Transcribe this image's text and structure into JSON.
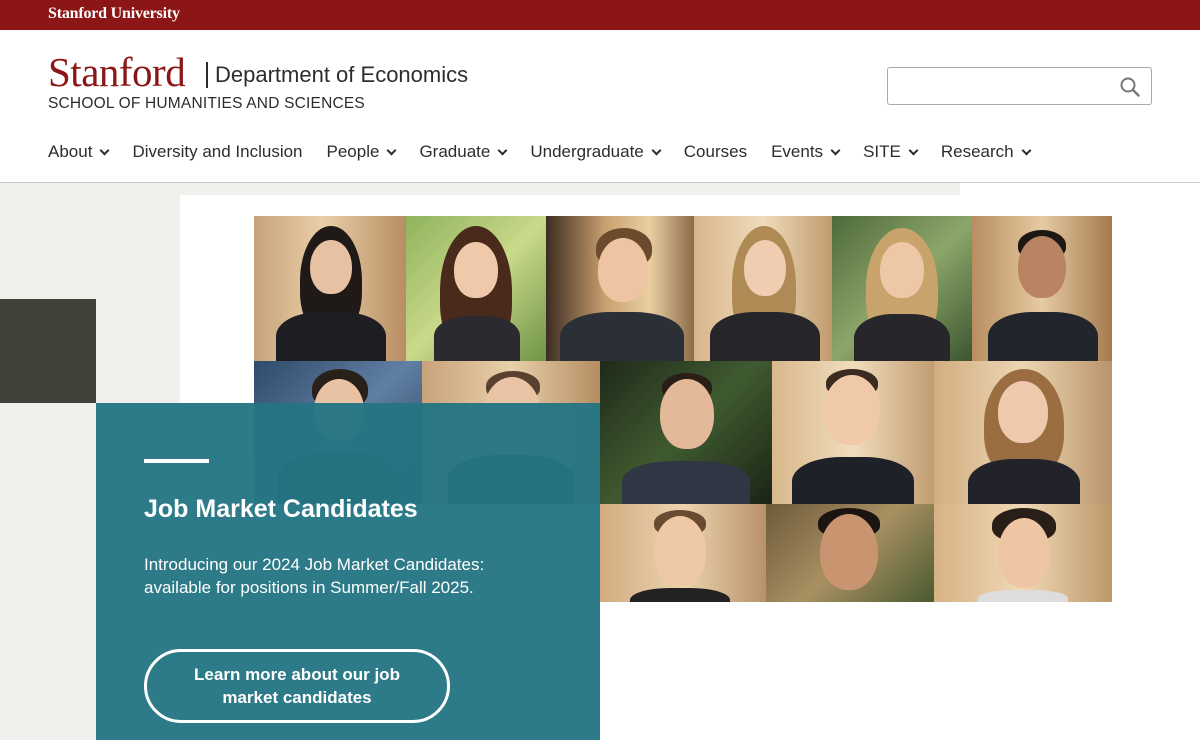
{
  "topbar": {
    "university_link": "Stanford University",
    "color": "#8c1515"
  },
  "brand": {
    "wordmark": "Stanford",
    "department": "Department of Economics",
    "school": "SCHOOL OF HUMANITIES AND SCIENCES"
  },
  "search": {
    "placeholder": "",
    "value": "",
    "icon": "search-icon"
  },
  "nav": {
    "items": [
      {
        "label": "About",
        "has_dropdown": true
      },
      {
        "label": "Diversity and Inclusion",
        "has_dropdown": false
      },
      {
        "label": "People",
        "has_dropdown": true
      },
      {
        "label": "Graduate",
        "has_dropdown": true
      },
      {
        "label": "Undergraduate",
        "has_dropdown": true
      },
      {
        "label": "Courses",
        "has_dropdown": false
      },
      {
        "label": "Events",
        "has_dropdown": true
      },
      {
        "label": "SITE",
        "has_dropdown": true
      },
      {
        "label": "Research",
        "has_dropdown": true
      }
    ]
  },
  "hero": {
    "image_alt": "",
    "panel": {
      "title": "Job Market Candidates",
      "text": "Introducing our 2024 Job Market Candidates: available for positions in Summer/Fall 2025.",
      "button_label": "Learn more about our job market candidates",
      "color": "#247583"
    }
  },
  "colors": {
    "cardinal": "#8c1515",
    "teal": "#247583",
    "dark_square": "#43423a",
    "hero_bg": "#f0efec"
  }
}
